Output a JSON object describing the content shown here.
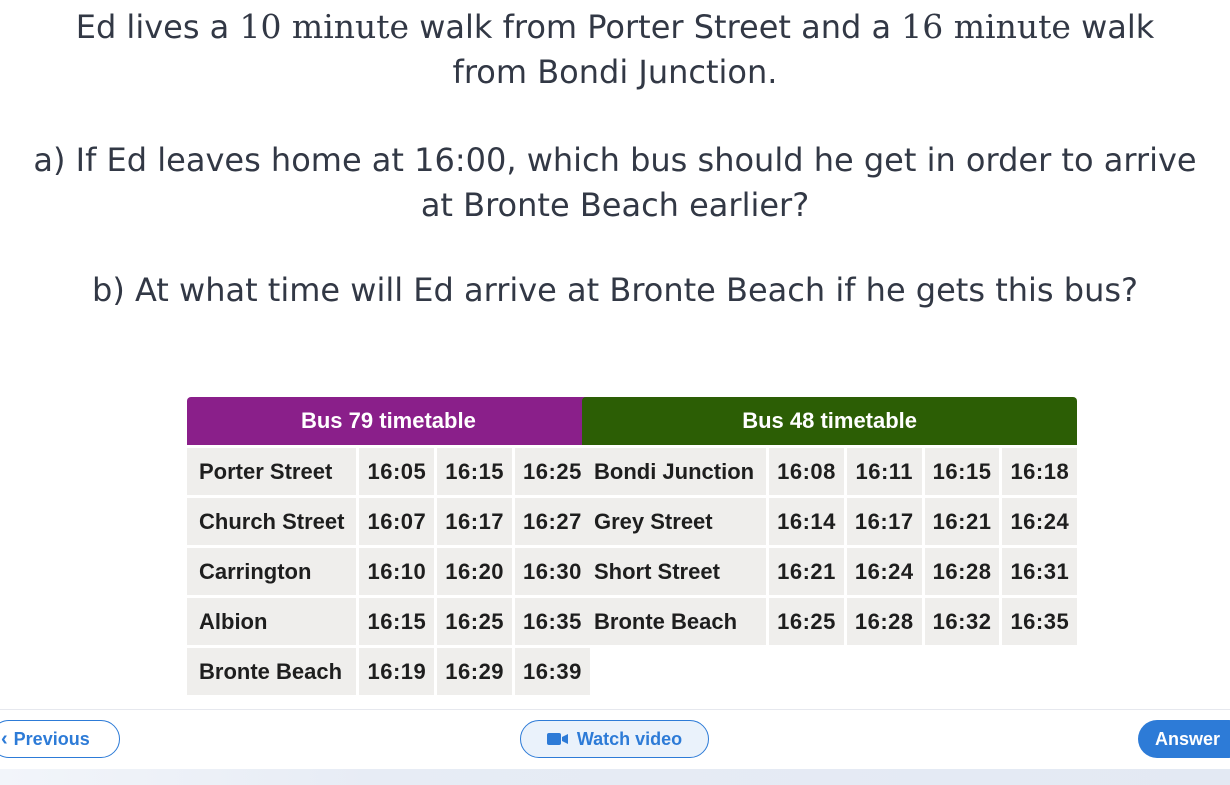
{
  "question": {
    "intro": {
      "p1": "Ed lives a ",
      "t1": "10 minute",
      "p2": " walk from Porter Street and a ",
      "t2": "16 minute",
      "p3": " walk",
      "line2": "from Bondi Junction."
    },
    "part_a": {
      "line1": "a) If Ed leaves home at 16:00, which bus should he get in order to arrive",
      "line2": "at Bronte Beach earlier?"
    },
    "part_b": "b) At what time will Ed arrive at Bronte Beach if he gets this bus?"
  },
  "bus79": {
    "title": "Bus 79 timetable",
    "header_color": "#8a1f8a",
    "rows": [
      {
        "stop": "Porter Street",
        "times": [
          "16:05",
          "16:15",
          "16:25"
        ]
      },
      {
        "stop": "Church Street",
        "times": [
          "16:07",
          "16:17",
          "16:27"
        ]
      },
      {
        "stop": "Carrington",
        "times": [
          "16:10",
          "16:20",
          "16:30"
        ]
      },
      {
        "stop": "Albion",
        "times": [
          "16:15",
          "16:25",
          "16:35"
        ]
      },
      {
        "stop": "Bronte Beach",
        "times": [
          "16:19",
          "16:29",
          "16:39"
        ]
      }
    ]
  },
  "bus48": {
    "title": "Bus 48 timetable",
    "header_color": "#2c5e05",
    "rows": [
      {
        "stop": "Bondi Junction",
        "times": [
          "16:08",
          "16:11",
          "16:15",
          "16:18"
        ]
      },
      {
        "stop": "Grey Street",
        "times": [
          "16:14",
          "16:17",
          "16:21",
          "16:24"
        ]
      },
      {
        "stop": "Short Street",
        "times": [
          "16:21",
          "16:24",
          "16:28",
          "16:31"
        ]
      },
      {
        "stop": "Bronte Beach",
        "times": [
          "16:25",
          "16:28",
          "16:32",
          "16:35"
        ]
      }
    ]
  },
  "nav": {
    "previous": "Previous",
    "watch_video": "Watch video",
    "answer": "Answer",
    "previous_icon": "chevron-left-icon",
    "video_icon": "video-camera-icon",
    "accent": "#2d7bd7"
  }
}
